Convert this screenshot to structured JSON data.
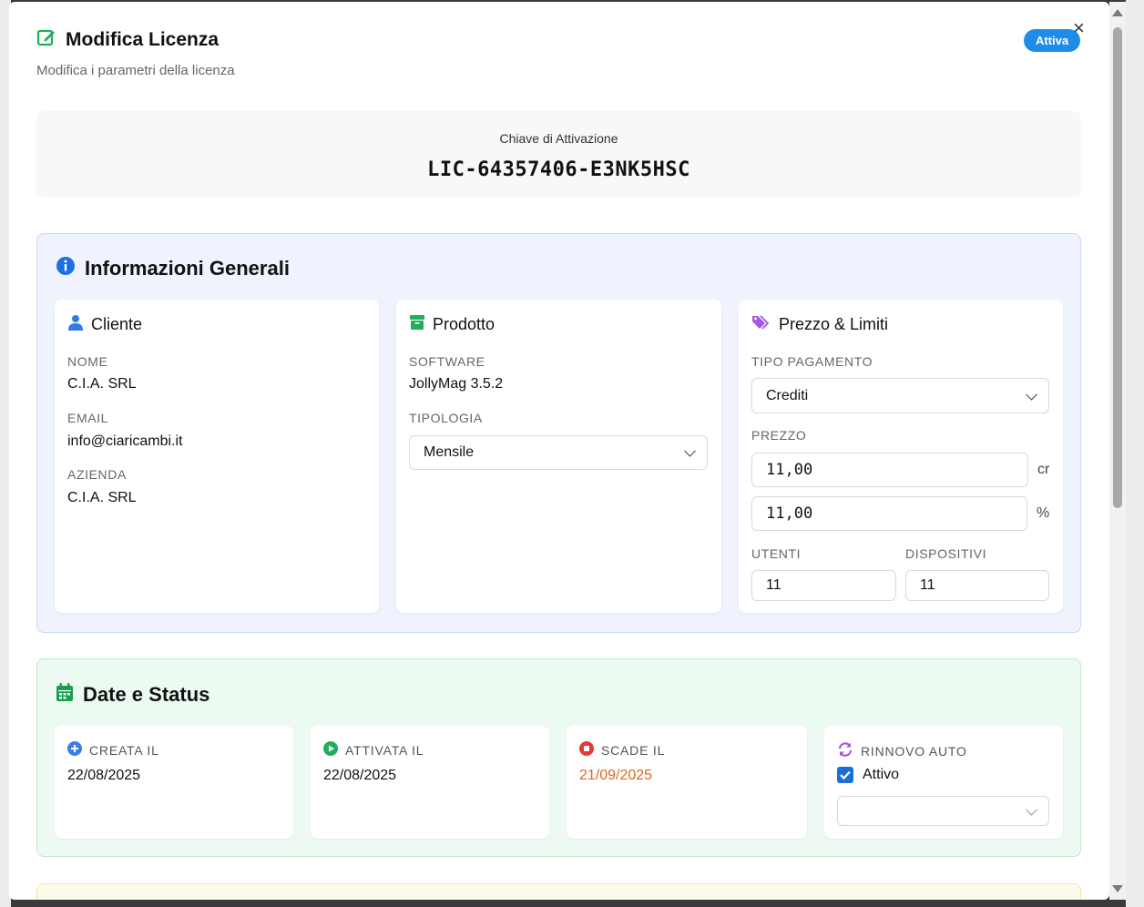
{
  "modal": {
    "title": "Modifica Licenza",
    "subtitle": "Modifica i parametri della licenza",
    "status_badge": "Attiva",
    "close_symbol": "×"
  },
  "key": {
    "label": "Chiave di Attivazione",
    "value": "LIC-64357406-E3NK5HSC"
  },
  "info": {
    "title": "Informazioni Generali",
    "cliente": {
      "title": "Cliente",
      "nome_label": "NOME",
      "nome": "C.I.A. SRL",
      "email_label": "EMAIL",
      "email": "info@ciaricambi.it",
      "azienda_label": "AZIENDA",
      "azienda": "C.I.A. SRL"
    },
    "prodotto": {
      "title": "Prodotto",
      "software_label": "SOFTWARE",
      "software": "JollyMag 3.5.2",
      "tipologia_label": "TIPOLOGIA",
      "tipologia": "Mensile"
    },
    "prezzo": {
      "title": "Prezzo & Limiti",
      "tipo_label": "TIPO PAGAMENTO",
      "tipo": "Crediti",
      "prezzo_label": "PREZZO",
      "prezzo": "11,00",
      "prezzo_unit": "cr",
      "percent": "11,00",
      "percent_unit": "%",
      "utenti_label": "UTENTI",
      "utenti": "11",
      "dispositivi_label": "DISPOSITIVI",
      "dispositivi": "11"
    }
  },
  "dates": {
    "title": "Date e Status",
    "creata_label": "CREATA IL",
    "creata": "22/08/2025",
    "attivata_label": "ATTIVATA IL",
    "attivata": "22/08/2025",
    "scade_label": "SCADE IL",
    "scade": "21/09/2025",
    "rinnovo_label": "RINNOVO AUTO",
    "rinnovo_checkbox_label": "Attivo",
    "rinnovo_select": ""
  },
  "colors": {
    "accent_blue": "#1e8de8",
    "expiry_orange": "#e0661b",
    "green_icon": "#1fae5b",
    "purple_icon": "#a257e6"
  }
}
